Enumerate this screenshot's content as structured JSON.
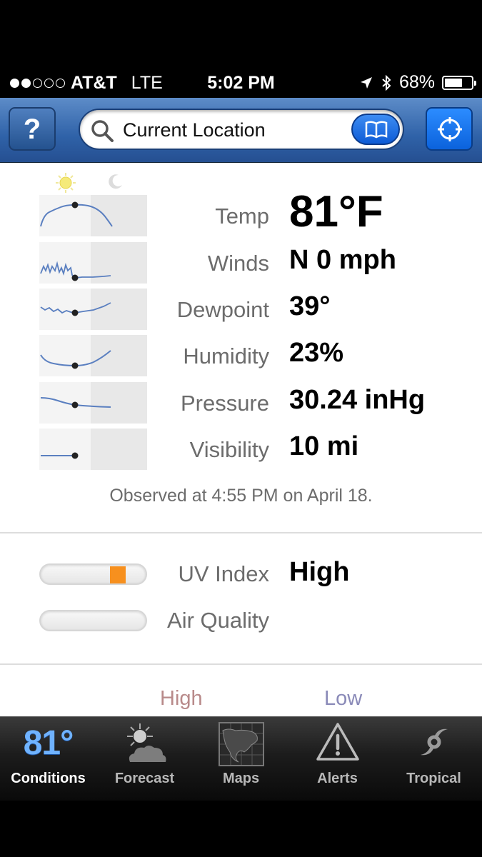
{
  "status_bar": {
    "signal_dots_filled": 2,
    "signal_dots_total": 5,
    "carrier": "AT&T",
    "network": "LTE",
    "time": "5:02 PM",
    "battery": "68%",
    "battery_level": 0.68
  },
  "nav": {
    "help_label": "?",
    "search_text": "Current Location"
  },
  "conditions": [
    {
      "label": "Temp",
      "value": "81°F"
    },
    {
      "label": "Winds",
      "value": "N  0 mph"
    },
    {
      "label": "Dewpoint",
      "value": "39°"
    },
    {
      "label": "Humidity",
      "value": "23%"
    },
    {
      "label": "Pressure",
      "value": "30.24 inHg"
    },
    {
      "label": "Visibility",
      "value": "10 mi"
    }
  ],
  "observed": "Observed at 4:55 PM on April 18.",
  "indices": [
    {
      "label": "UV Index",
      "value": "High",
      "level": 0.8
    },
    {
      "label": "Air Quality",
      "value": ""
    }
  ],
  "forecast_header": {
    "high": "High",
    "low": "Low"
  },
  "colors": {
    "nav_blue": "#2f62a8",
    "uv_marker": "#f7901e",
    "active_tab_temp": "#6fb2ff",
    "high_label": "#b88a8a",
    "low_label": "#8a8ab8"
  },
  "tabs": [
    {
      "label": "Conditions",
      "icon": "temperature-icon",
      "icon_text": "81°",
      "active": true
    },
    {
      "label": "Forecast",
      "icon": "sun-cloud-icon",
      "active": false
    },
    {
      "label": "Maps",
      "icon": "map-icon",
      "active": false
    },
    {
      "label": "Alerts",
      "icon": "warning-icon",
      "active": false
    },
    {
      "label": "Tropical",
      "icon": "hurricane-icon",
      "active": false
    }
  ]
}
